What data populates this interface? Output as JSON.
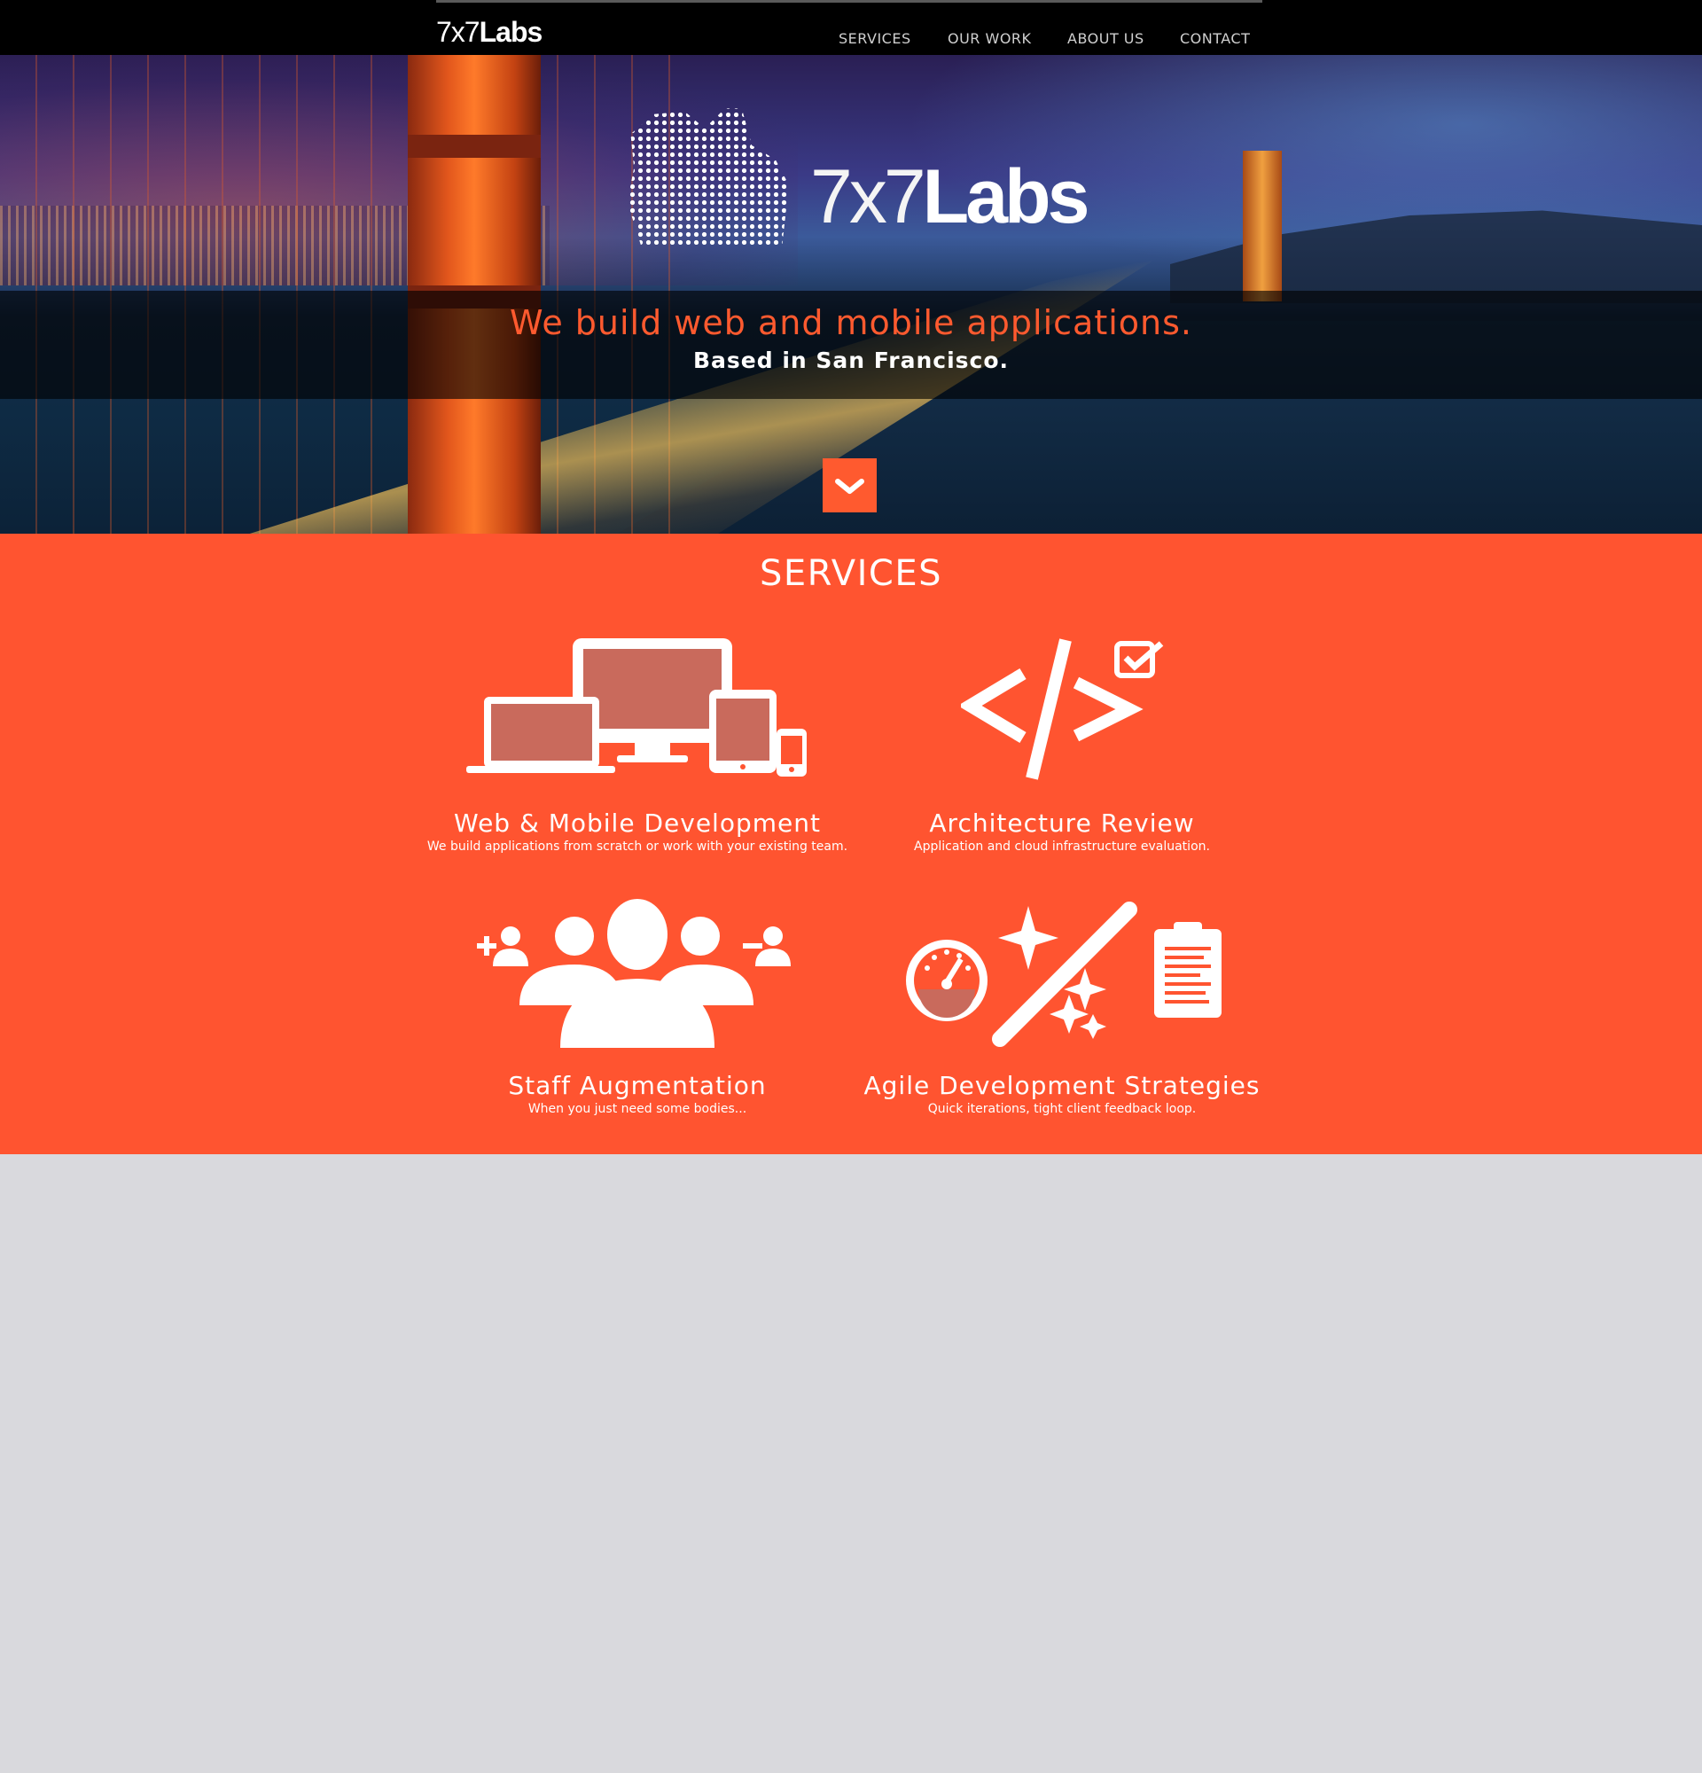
{
  "header": {
    "brand_thin": "7x7",
    "brand_bold": "Labs",
    "nav": [
      "SERVICES",
      "OUR WORK",
      "ABOUT US",
      "CONTACT"
    ]
  },
  "hero": {
    "logo_thin": "7x7",
    "logo_bold": "Labs",
    "tagline": "We build web and mobile applications.",
    "subline": "Based in San Francisco."
  },
  "services": {
    "title": "SERVICES",
    "items": [
      {
        "name": "Web & Mobile Development",
        "desc": "We build applications from scratch or work with your existing team.",
        "icon": "devices-icon"
      },
      {
        "name": "Architecture Review",
        "desc": "Application and cloud infrastructure evaluation.",
        "icon": "code-check-icon"
      },
      {
        "name": "Staff Augmentation",
        "desc": "When you just need some bodies...",
        "icon": "team-icon"
      },
      {
        "name": "Agile Development Strategies",
        "desc": "Quick iterations, tight client feedback loop.",
        "icon": "agile-tools-icon"
      }
    ]
  },
  "colors": {
    "accent": "#ff5430",
    "header": "#000000",
    "page_bg": "#d9d9dd"
  }
}
